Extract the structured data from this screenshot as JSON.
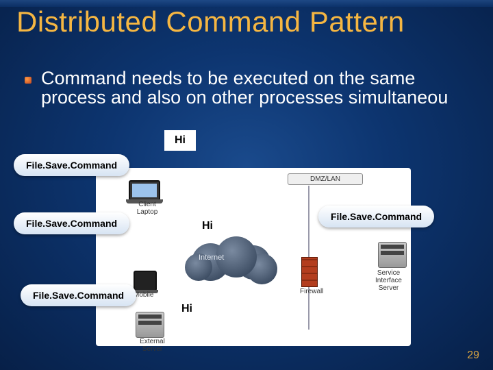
{
  "title": "Distributed Command Pattern",
  "body": "Command needs to be executed on the same process and also on other processes simultaneou",
  "pills": {
    "p1": "File.Save.Command",
    "p2": "File.Save.Command",
    "p3": "File.Save.Command",
    "p4": "File.Save.Command"
  },
  "hi": {
    "h1": "Hi",
    "h2": "Hi",
    "h3": "Hi"
  },
  "diagram": {
    "dmz": "DMZ/LAN",
    "cloud": "Internet",
    "client": "Client Laptop",
    "mobile": "Mobile",
    "firewall": "Firewall",
    "service_server": "Service Interface Server",
    "external_server": "External Server"
  },
  "page": "29"
}
